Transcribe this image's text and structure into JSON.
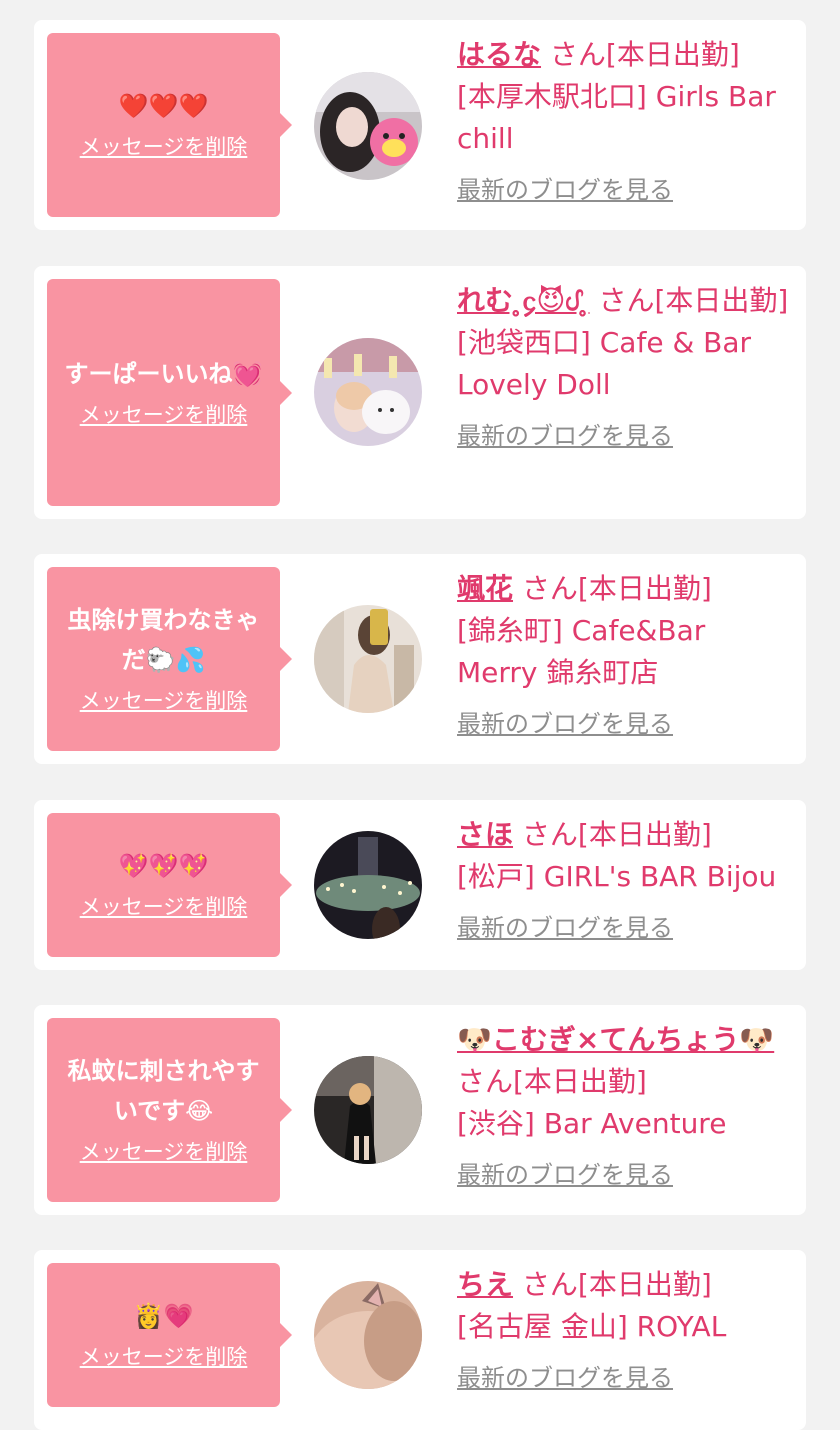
{
  "colors": {
    "background": "#f2f2f2",
    "bubble": "#f994a2",
    "accent": "#e03a6c",
    "muted": "#8e8e8e"
  },
  "cards": [
    {
      "message": "❤️❤️❤️",
      "delete_label": "メッセージを削除",
      "name": "はるな",
      "san_status": "さん[本日出勤]",
      "shop": "[本厚木駅北口] Girls Bar chill",
      "blog_label": "最新のブログを見る",
      "avatar_icon": "girl-with-cartoon-sticker-photo"
    },
    {
      "message": "すーぱーいいね💓",
      "delete_label": "メッセージを削除",
      "name": "れむ ̥̥᧔😈ᦔ ̥̥",
      "san_status": "さん[本日出勤]",
      "shop": "[池袋西口] Cafe & Bar Lovely Doll",
      "blog_label": "最新のブログを見る",
      "avatar_icon": "girl-with-plush-photo"
    },
    {
      "message": "虫除け買わなきゃだ🐑💦",
      "delete_label": "メッセージを削除",
      "name": "颯花",
      "san_status": "さん[本日出勤]",
      "shop": "[錦糸町] Cafe&Bar Merry 錦糸町店",
      "blog_label": "最新のブログを見る",
      "avatar_icon": "mirror-selfie-photo"
    },
    {
      "message": "💖💖💖",
      "delete_label": "メッセージを削除",
      "name": "さほ",
      "san_status": "さん[本日出勤]",
      "shop": "[松戸] GIRL's BAR Bijou",
      "blog_label": "最新のブログを見る",
      "avatar_icon": "night-illumination-photo"
    },
    {
      "message": "私蚊に刺されやすいです😂",
      "delete_label": "メッセージを削除",
      "name": "🐶こむぎ×てんちょう🐶",
      "san_status": "さん[本日出勤]",
      "shop": "[渋谷] Bar Aventure",
      "blog_label": "最新のブログを見る",
      "avatar_icon": "dog-face-portrait-photo"
    },
    {
      "message": "👸💗",
      "delete_label": "メッセージを削除",
      "name": "ちえ",
      "san_status": "さん[本日出勤]",
      "shop": "[名古屋 金山] ROYAL",
      "blog_label": "最新のブログを見る",
      "avatar_icon": "cat-ear-headband-photo"
    }
  ]
}
